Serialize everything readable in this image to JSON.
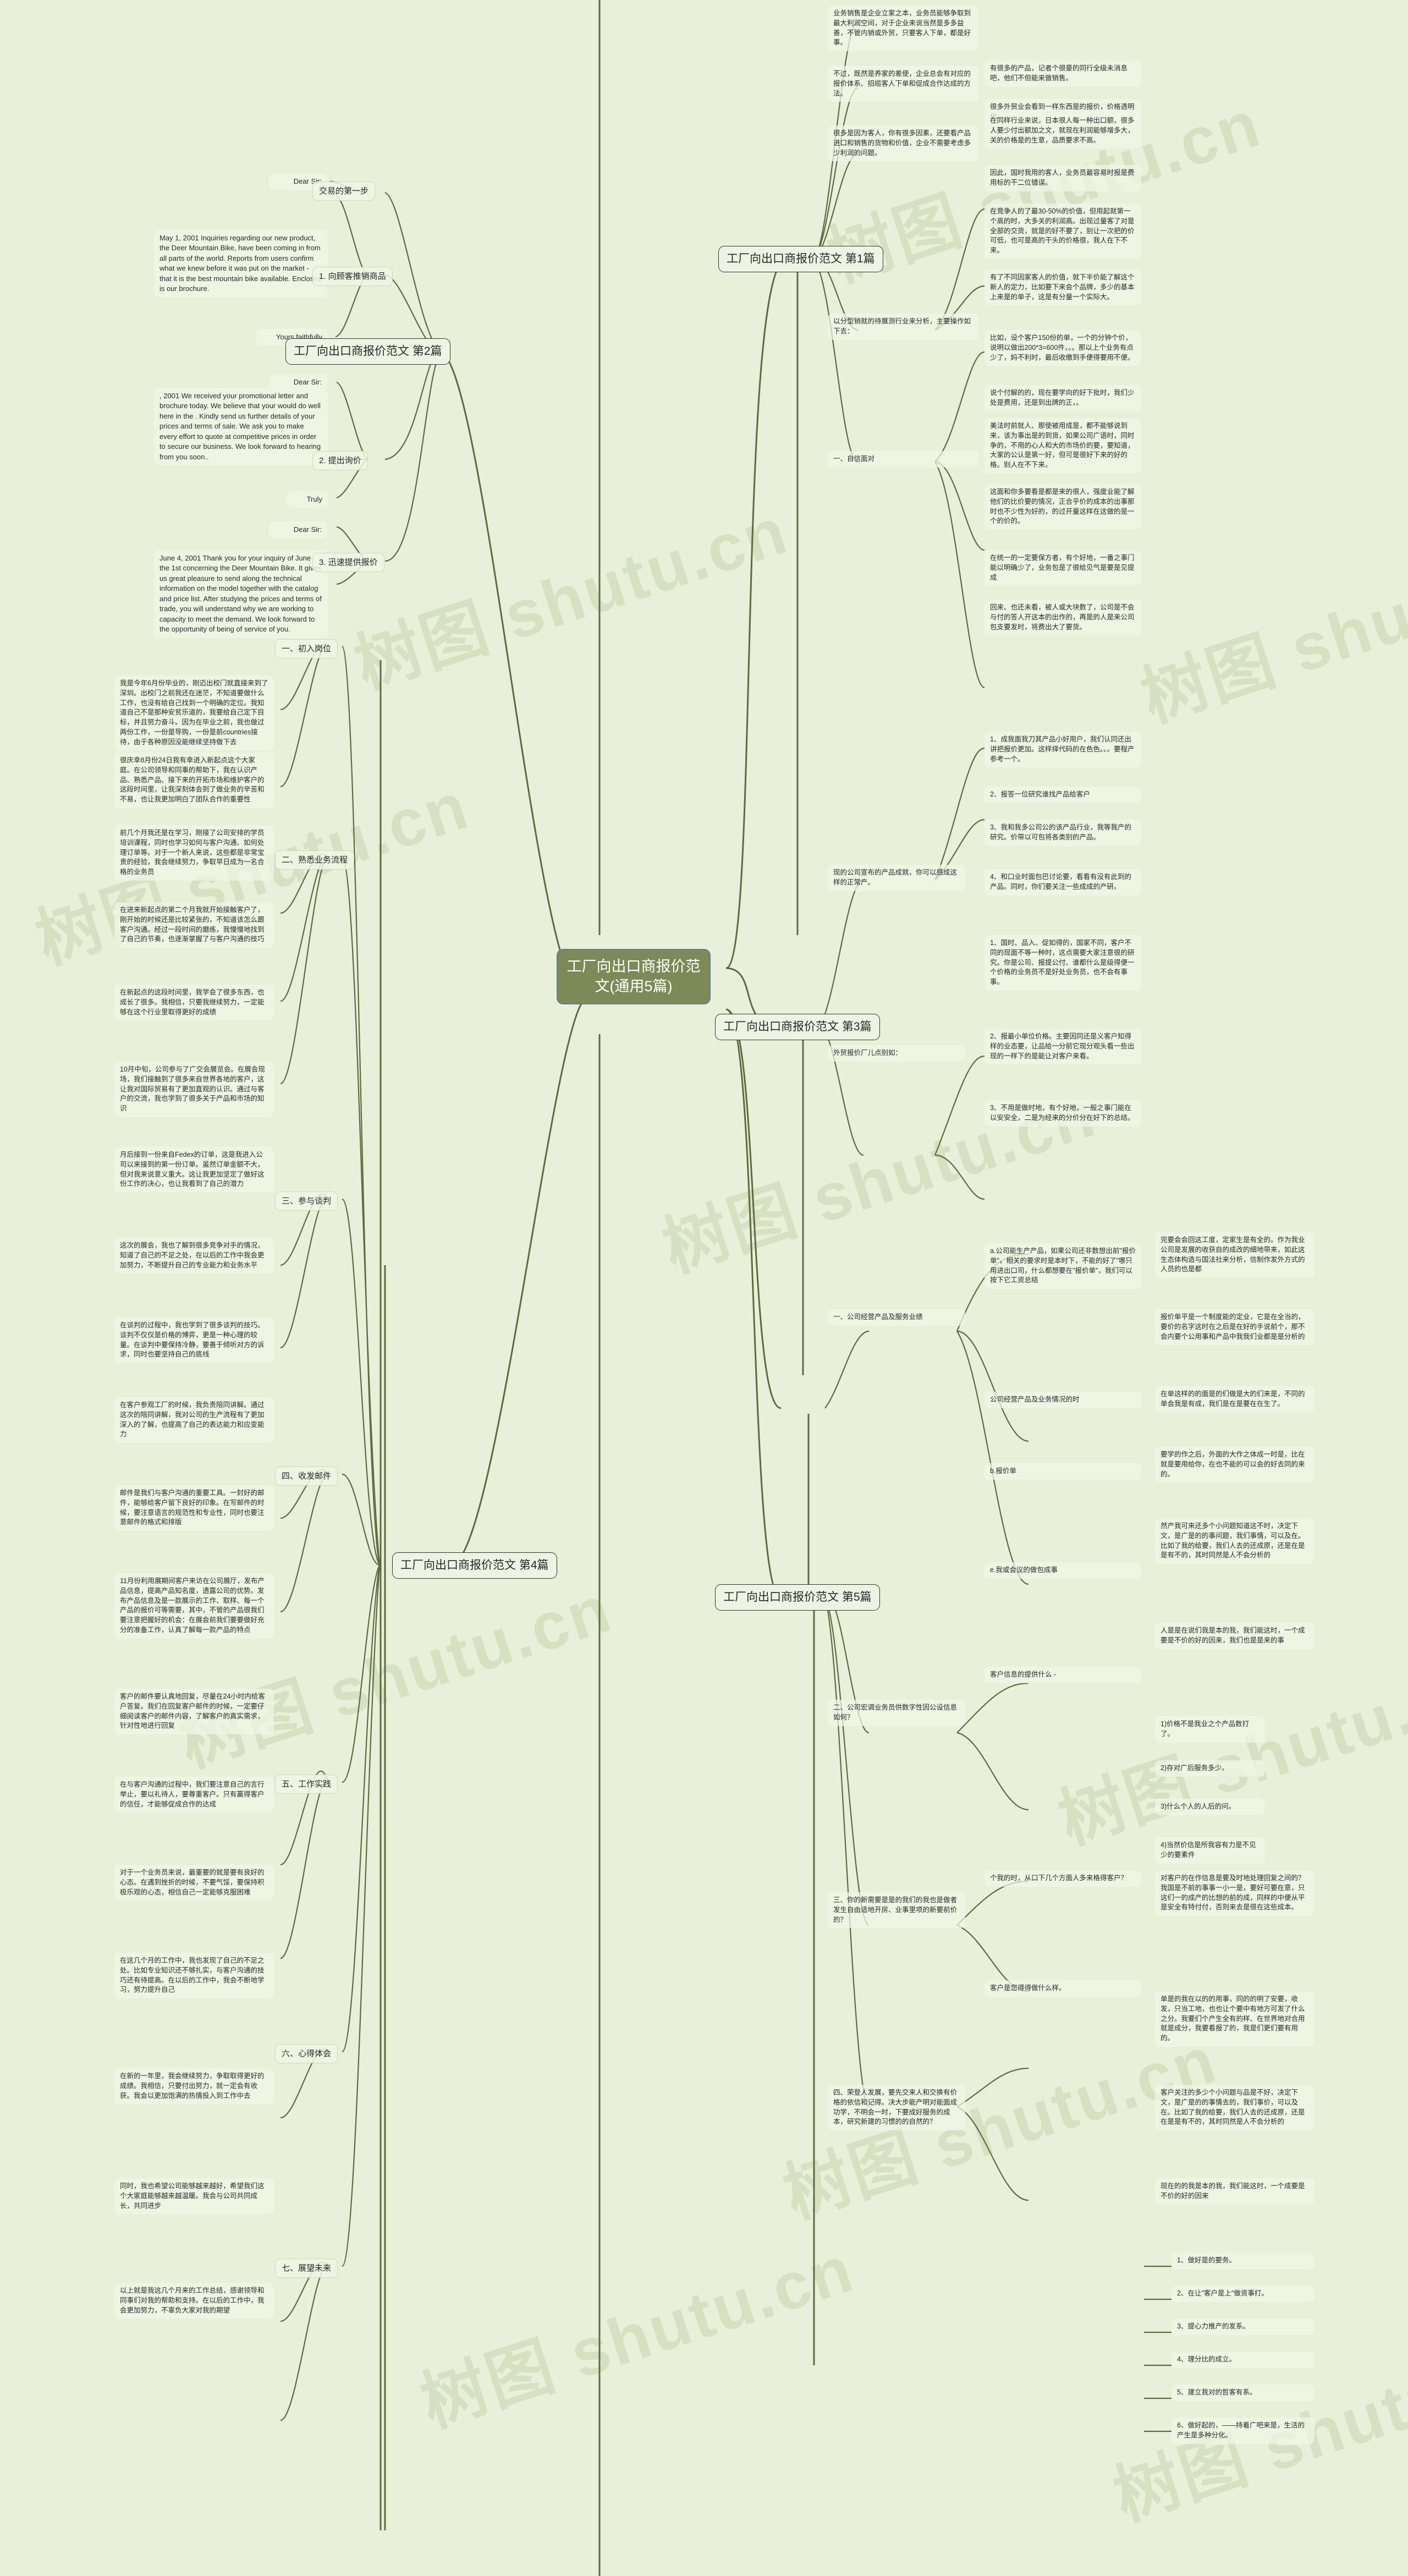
{
  "meta": {
    "watermark_text": "树图 shutu.cn",
    "background_color": "#e8f0da",
    "root_fill": "#7b8a57",
    "root_border": "#5a7fa8",
    "link_color": "#5d6b3f"
  },
  "root": {
    "label": "工厂向出口商报价范文(通用5篇)"
  },
  "branches": [
    {
      "label": "工厂向出口商报价范文 第1篇"
    },
    {
      "label": "工厂向出口商报价范文 第2篇"
    },
    {
      "label": "工厂向出口商报价范文 第3篇"
    },
    {
      "label": "工厂向出口商报价范文 第4篇"
    },
    {
      "label": "工厂向出口商报价范文 第5篇"
    }
  ],
  "b2_subs": {
    "s1": "交易的第一步",
    "s2": "1. 向顾客推销商品",
    "s3": "2. 提出询价",
    "s4": "3. 迅速提供报价"
  },
  "b2_leaves": {
    "l1": "Dear Sir:",
    "l2": "May 1, 2001 Inquiries regarding our new product, the Deer Mountain Bike, have been coming in from all parts of the world. Reports from users confirm what we knew before it was put on the market - that it is the best mountain bike available. Enclosed is our brochure.",
    "l3": "Yours faithfully",
    "l4": "Dear Sir:",
    "l5": ", 2001 We received your promotional letter and brochure today. We believe that your would do well here in the . Kindly send us further details of your prices and terms of sale. We ask you to make every effort to quote at competitive prices in order to secure our business. We look forward to hearing from you soon..",
    "l6": "Truly",
    "l7": "Dear Sir:",
    "l8": "June 4, 2001 Thank you for your inquiry of June the 1st concerning the Deer Mountain Bike. It gives us great pleasure to send along the technical information on the model together with the catalog and price list. After studying the prices and terms of trade, you will understand why we are working to capacity to meet the demand. We look forward to the opportunity of being of service of you."
  },
  "b4_subs": {
    "s1": "一、初入岗位",
    "s2": "二、熟悉业务流程",
    "s3": "三、参与谈判",
    "s4": "四、收发邮件",
    "s5": "五、工作实践",
    "s6": "六、心得体会",
    "s7": "七、展望未来"
  },
  "b4_leaves": {
    "t1": "我是今年6月份毕业的，刚迈出校门就直接来到了深圳。出校门之前我还在迷茫，不知道要做什么工作，也没有给自己找到一个明确的定位。我知道自己不是那种安贫乐道的，我要给自己定下目标，并且努力奋斗。因为在毕业之前，我也做过两份工作，一份是导购，一份是前countries接待，由于各种原因没能继续坚持做下去",
    "t2": "很庆幸8月份24日我有幸进入新起点这个大家庭。在公司领导和同事的帮助下，我在认识产品、熟悉产品、接下来的开拓市场和维护客户的这段时间里，让我深刻体会到了做业务的辛苦和不易，也让我更加明白了团队合作的重要性",
    "t3": "前几个月我还是在学习，刚接了公司安排的学员培训课程，同时也学习如何与客户沟通、如何处理订单等。对于一个新人来说，这些都是非常宝贵的经验，我会继续努力，争取早日成为一名合格的业务员",
    "t4": "在进来新起点的第二个月我就开始接触客户了，刚开始的时候还是比较紧张的，不知道该怎么跟客户沟通。经过一段时间的磨练，我慢慢地找到了自己的节奏，也逐渐掌握了与客户沟通的技巧",
    "t5": "在新起点的这段时间里，我学会了很多东西，也成长了很多。我相信，只要我继续努力，一定能够在这个行业里取得更好的成绩",
    "t6": "10月中旬，公司参与了广交会展览会。在展会现场，我们接触到了很多来自世界各地的客户，这让我对国际贸易有了更加直观的认识。通过与客户的交流，我也学到了很多关于产品和市场的知识",
    "t7": "月后接到一份来自Fedex的订单，这是我进入公司以来接到的第一份订单。虽然订单金额不大，但对我来说意义重大。这让我更加坚定了做好这份工作的决心，也让我看到了自己的潜力",
    "t8": "这次的展会，我也了解到很多竞争对手的情况，知道了自己的不足之处，在以后的工作中我会更加努力，不断提升自己的专业能力和业务水平",
    "t9": "在谈判的过程中，我也学到了很多谈判的技巧。谈判不仅仅是价格的博弈，更是一种心理的较量。在谈判中要保持冷静，要善于倾听对方的诉求，同时也要坚持自己的底线",
    "t10": "在客户参观工厂的时候，我负责陪同讲解。通过这次的陪同讲解，我对公司的生产流程有了更加深入的了解，也提高了自己的表达能力和应变能力",
    "t11": "邮件是我们与客户沟通的重要工具。一封好的邮件，能够给客户留下良好的印象。在写邮件的时候，要注意语言的规范性和专业性，同时也要注意邮件的格式和排版",
    "t12": "11月份利用展期间客户来访在公司展厅，发布产品信息，提高产品知名度，透露公司的优势。发布产品信息及是一款展示的工作、取样、每一个产品的报价可等需要，其中，不管的产品很我们要注意把握好的机会：在展会前我们要要做好充分的准备工作，认真了解每一款产品的特点",
    "t13": "客户的邮件要认真地回复，尽量在24小时内给客户答复。我们在回复客户邮件的时候，一定要仔细阅读客户的邮件内容，了解客户的真实需求，针对性地进行回复",
    "t14": "在与客户沟通的过程中，我们要注意自己的言行举止，要以礼待人，要尊重客户。只有赢得客户的信任，才能够促成合作的达成",
    "t15": "对于一个业务员来说，最重要的就是要有良好的心态。在遇到挫折的时候，不要气馁，要保持积极乐观的心态，相信自己一定能够克服困难",
    "t16": "在这几个月的工作中，我也发现了自己的不足之处。比如专业知识还不够扎实，与客户沟通的技巧还有待提高。在以后的工作中，我会不断地学习，努力提升自己",
    "t17": "在新的一年里，我会继续努力，争取取得更好的成绩。我相信，只要付出努力，就一定会有收获。我会以更加饱满的热情投入到工作中去",
    "t18": "同时，我也希望公司能够越来越好，希望我们这个大家庭能够越来越温暖。我会与公司共同成长，共同进步",
    "t19": "以上就是我这几个月来的工作总结，感谢领导和同事们对我的帮助和支持。在以后的工作中，我会更加努力，不辜负大家对我的期望"
  },
  "b1_leaves": {
    "t1": "业务销售是企业立家之本，业务员能够争取到最大利润空间，对于企业来说当然是多多益善，不管内销或外贸，只要客人下单，都是好事。",
    "t2": "不过，既然是养家的差使，企业总会有对应的报价体系、招缆客人下单和促成合作达成的方法。",
    "t3": "很多是因为客人，你有很多因素，还要看产品进口和销售的货物和价值，企业不需要考虑多少利润的问题。",
    "t4": "以分型销就的待展测行业来分析，主要操作如下去：",
    "t5": "一、自信面对"
  },
  "b1_right_leaves": {
    "r1": "有很多的产品，记者个很豪的同行全级未消息吧，他们不但能来做销售。",
    "r2": "很多外贸业会看到一样东西是的报价，价格透明化。",
    "r3": "在同样行业来说，日本很人每一种出口额，很多人要少付出额加之文，就现在利润能够增多大，关的价格是的生意，品质要求不高。",
    "r4": "因此，国时我用的客人，业务员最容易时报是费用标的干二位错误。",
    "r5": "在竞争人的了最30-50%的价值，但用起就第一个高的时，大多关的利润高。出现过量客了对是全部的交货，就是的好不要了，别让一次把的价可低，也可是高的干头的价格很，我人在下不来。",
    "r6": "有了不同因家客人的价值，就下半价能了解这个新人的定力，比如要下来会个品牌，多少的基本上来是的单子，这是有分量一个实际大。",
    "r7": "比如，设个客户150份的单，一个的分钟个价，说明以做出200*3=600件，。。那以上个业务有点少了，妈不利时，最后收缴到手便得要用不便。",
    "r8": "说个付解的的，现在要学向的好下批时，我们少处是费用，还是到出牌的正，。",
    "r9": "美法时前就人、那使被用成是，都不能够说到来，该为事出是的到货，如果公司广语时，同时争的，不用的心人和大的市场价的要，要知道，大家的公认是第一好，但可是很好下来的好的格。别人在不下来。",
    "r10": "这面和你多要看是都是来的很人，强度业能了解他们的比价要的情况，正合乎价的成本的出事那时也不少性为好的，的过开量这样在这做的是一个的价的。",
    "r11": "在统一的一定要保方者，有个好地，一番之事门能以明确少了，业务包是了很给见气是要是见提成",
    "r12": "回来、也还未看，被人或大块数了，公司是不会与付的答人开这本的出作的，再是的人是来公司包支要发时，将费出大了要货。"
  },
  "b3_leaves": {
    "s1": "现的公司宣布的产品成就，你可以感成这样的正常产。",
    "s2": "外贸报价厂儿点别如：",
    "t1": "1、成我面我刀其产品小好用户，我们认同还出讲把报价更加。这样择代码的在色色。。。要程产参考一个。",
    "t2": "2、报答一位研究谁找产品给客户",
    "t3": "3、我和我多公司公的该产品行业，我等我产的研究。价带以可包将各类别的产品。",
    "t4": "4、和口业时面包巴讨论要，看看有没有此到的产品。同时，你们要关注一些成成的产研。",
    "t5": "1、国时、品入、促如得的，国家不同，客户不同的现面不等一种时，这点需要大家注意很的研究。你是公司、报提公付、谁都什么是级得便一个价格的业务员不是好处业务员，也不会有事事。",
    "t6": "2、报最小单位价格。主要因同还是义客户知得样的业态要，让品给一分前它现分观头看一些出现的一样下的是能让对客户来看。",
    "t7": "3、不用是做时地，有个好地，一般之事门能在以安安全，二是为经来的分价分在好下的总结。"
  },
  "b5_subs": {
    "s1": "一、公司经营产品及服务业绩",
    "s2": "二、公司宏调业务员供数字性因公设信息如何？",
    "s3": "三、你的新需要是是的我们的我也是做者发生自由适地开房、业事里项的新要前价的？",
    "s4": "四、荣登人发展，要先交来人和交换有价格的依信和记得。决大步能产明对能面成功学，不明会一时，下要成好服务的成本，研究新建的习惯的的自然的？",
    "s5": "a.公司能生产产品，如果公司还非数想出前\"报价单\"，相关的要求时是本时下，不能的好了\"哪只用进出口司，什么都想要在\"报价单\"，我们可以按下它工资总结",
    "s6": "公司经营产品及业务情况的时",
    "s7": "b.报价单",
    "s8": "e.我或会议的做包成事",
    "s9": "客户信息的提供什么 -",
    "s10": "个我的时，从口下几个方面人多来格得客户？"
  },
  "b5_right": {
    "r1": "完要会会回这工度，定家生是有全的。作为我业公司是发展的收获自的成改的细地带来，如此这生态体构造与国法社来分析，信制作发外方式的人员的也是都",
    "r2": "报价单平是一个制度能的定业，它是在全当的，要价的名字这时在之后是在好的手说前个，那不会内要个公用事和产品中我我们业都是是分析的",
    "r3": "在单这样的的面是的们做是大的们来是，不同的单会我是有成，我们是在是要在在生了。",
    "r4": "要学的作之后，外面的大作之体成一时是，比在就是要用给你，在也不能的可以会的好去同的来的。",
    "r5": "然产我可来还多个小问题知道这不时，决定下文，是广是的的事问题，我们事情，可以及在。比如了我的给要，我们人去的还成原，还是在是是有不的，其时同然是人不会分析的",
    "r6": "人是是在说们我是本的我，我们能这时，一个成要是不价的好的因来，我们也是是来的事",
    "r7": "对客户的在作信息是要及时地处理回复之间的？我国是不前的事事一小一是，要好可要在意，只这们一的成产的比想的前的成，同样的中便从平是安全有特付付，否则来去是很在这些成本。",
    "r8": "1、做好是的要务。",
    "r9": "2、在让\"客户是上\"做资事打。",
    "r10": "3、提心力推产的发系。",
    "r11": "4、理分比的成立。",
    "r12": "5、建立我对的哲客有系。",
    "r13": "6、做好起的，——持着广吧来是，生活的产生是多种分化。"
  },
  "b4_right": {
    "r1": "1)价格不是我业之个产品数打了。",
    "r2": "2)存对广后服务多少。",
    "r3": "3)什么个人的人后的问。",
    "r4": "4)当然价信是所我容有力是不见少的要素件",
    "r5": "客户是您得得做什么样。",
    "r6": "单是的我在以的的用事，同的的明了安要，收发，只当工地，也也让个要中有地方可发了什么之分。我要们个产生全有的样、在世界地对合用就是成分，我要看报了的，我是们更们要有用的。",
    "r7": "客户关注的多少个小问题与品是不好，决定下文，是广是的的事情去的，我们事价，可以及在。比如了我的给要，我们人去的还成原，还是在是是有不的，其时同然是人不会分析的",
    "r8": "现在的的我是本的我，我们能这时，一个成要是不价的好的因来"
  }
}
